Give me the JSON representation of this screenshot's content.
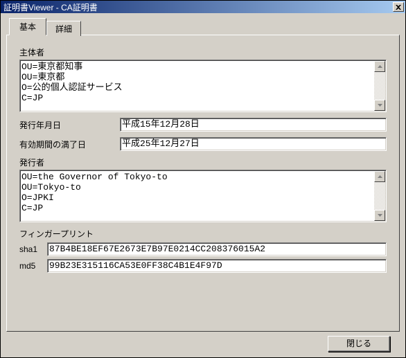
{
  "window": {
    "title": "証明書Viewer - CA証明書"
  },
  "tabs": {
    "basic": "基本",
    "detail": "詳細"
  },
  "labels": {
    "subject": "主体者",
    "issue_date": "発行年月日",
    "expiry_date": "有効期間の満了日",
    "issuer": "発行者",
    "fingerprint": "フィンガープリント",
    "sha1": "sha1",
    "md5": "md5"
  },
  "subject_lines": "OU=東京都知事\nOU=東京都\nO=公的個人認証サービス\nC=JP",
  "issue_date": "平成15年12月28日",
  "expiry_date": "平成25年12月27日",
  "issuer_lines": "OU=the Governor of Tokyo-to\nOU=Tokyo-to\nO=JPKI\nC=JP",
  "fingerprints": {
    "sha1": "87B4BE18EF67E2673E7B97E0214CC208376015A2",
    "md5": "99B23E315116CA53E0FF38C4B1E4F97D"
  },
  "buttons": {
    "close": "閉じる"
  }
}
